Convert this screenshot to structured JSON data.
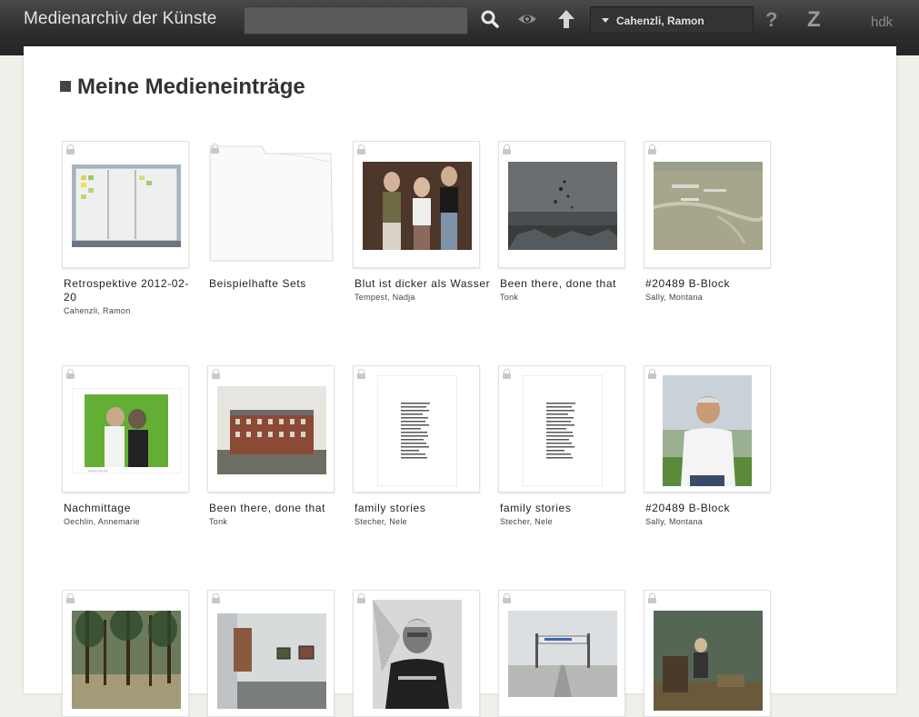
{
  "header": {
    "brand": "Medienarchiv der Künste",
    "search_placeholder": "",
    "user_name": "Cahenzli, Ramon",
    "help_label": "?",
    "logo_label": "Z",
    "org_label": "hdk",
    "icons": [
      "search-icon",
      "eye-icon",
      "upload-arrow-icon",
      "chevron-down-icon"
    ]
  },
  "page": {
    "title": "Meine Medieneinträge"
  },
  "rows": [
    [
      {
        "title": "Retrospektive 2012-02-20",
        "author": "Cahenzli, Ramon",
        "kind": "whiteboard"
      },
      {
        "title": "Beispielhafte Sets",
        "author": "",
        "kind": "folder"
      },
      {
        "title": "Blut ist dicker als Wasser",
        "author": "Tempest, Nadja",
        "kind": "three-women"
      },
      {
        "title": "Been there, done that",
        "author": "Tonk",
        "kind": "dark-room"
      },
      {
        "title": "#20489 B-Block",
        "author": "Sally, Montana",
        "kind": "aerial"
      }
    ],
    [
      {
        "title": "Nachmittage",
        "author": "Oechlin, Annemarie",
        "kind": "kids"
      },
      {
        "title": "Been there, done that",
        "author": "Tonk",
        "kind": "building"
      },
      {
        "title": "family stories",
        "author": "Stecher, Nele",
        "kind": "document"
      },
      {
        "title": "family stories",
        "author": "Stecher, Nele",
        "kind": "document"
      },
      {
        "title": "#20489 B-Block",
        "author": "Sally, Montana",
        "kind": "man-portrait"
      }
    ],
    [
      {
        "title": "",
        "author": "",
        "kind": "forest"
      },
      {
        "title": "",
        "author": "",
        "kind": "gallery"
      },
      {
        "title": "",
        "author": "",
        "kind": "portrait-bw"
      },
      {
        "title": "",
        "author": "",
        "kind": "gate"
      },
      {
        "title": "",
        "author": "",
        "kind": "green-room"
      }
    ]
  ]
}
